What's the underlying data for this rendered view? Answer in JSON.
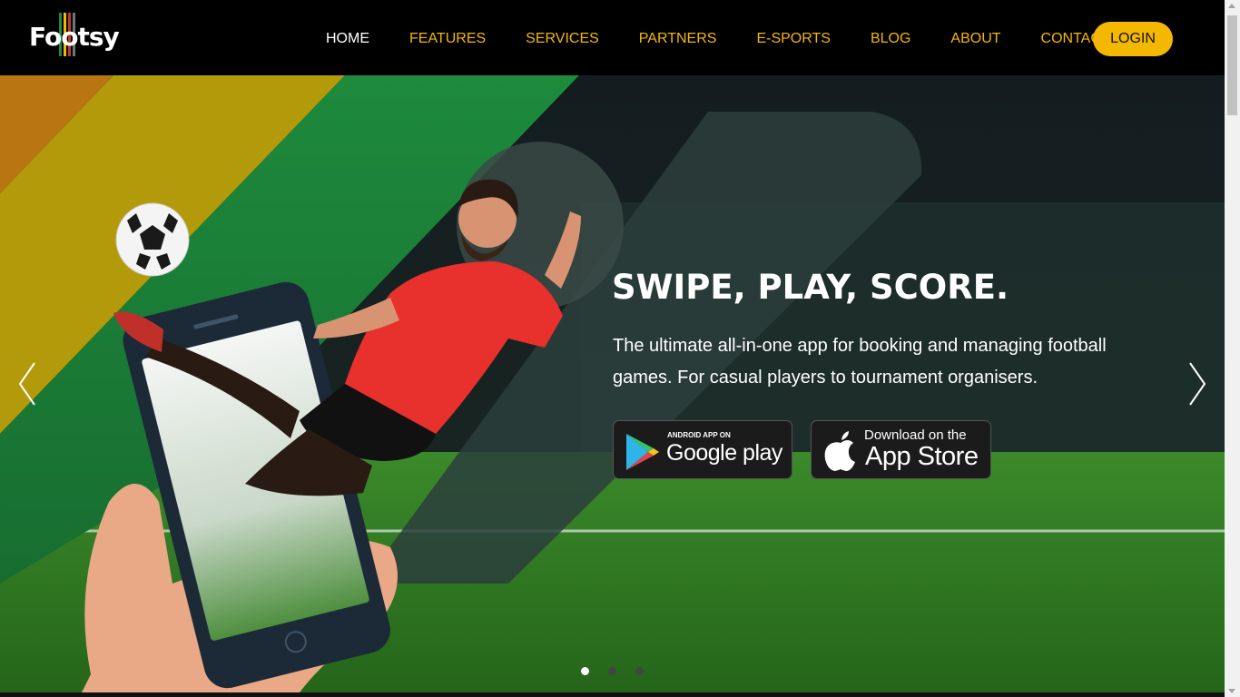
{
  "brand": {
    "name": "Footsy",
    "bar_colors": [
      "#1f8a3b",
      "#f5b800",
      "#c0392b",
      "#6c757d"
    ]
  },
  "nav": {
    "items": [
      {
        "label": "HOME",
        "active": true
      },
      {
        "label": "FEATURES",
        "active": false
      },
      {
        "label": "SERVICES",
        "active": false
      },
      {
        "label": "PARTNERS",
        "active": false
      },
      {
        "label": "E-SPORTS",
        "active": false
      },
      {
        "label": "BLOG",
        "active": false
      },
      {
        "label": "ABOUT",
        "active": false
      },
      {
        "label": "CONTACT",
        "active": false
      }
    ],
    "login_label": "LOGIN"
  },
  "hero": {
    "title": "SWIPE, PLAY, SCORE.",
    "description": "The ultimate all-in-one app for booking and managing football games. For casual players to tournament organisers.",
    "google_play": {
      "small": "ANDROID APP ON",
      "big": "Google play"
    },
    "app_store": {
      "small": "Download on the",
      "big": "App Store"
    },
    "prev_icon": "chevron-left-icon",
    "next_icon": "chevron-right-icon",
    "slides": 3,
    "active_slide": 1
  },
  "colors": {
    "accent": "#f5b800",
    "stripe_orange": "#b87512",
    "stripe_yellow": "#b39a0a",
    "stripe_green": "#1d8a3c",
    "pitch": "#2f7a1f",
    "jersey": "#e8302d"
  }
}
